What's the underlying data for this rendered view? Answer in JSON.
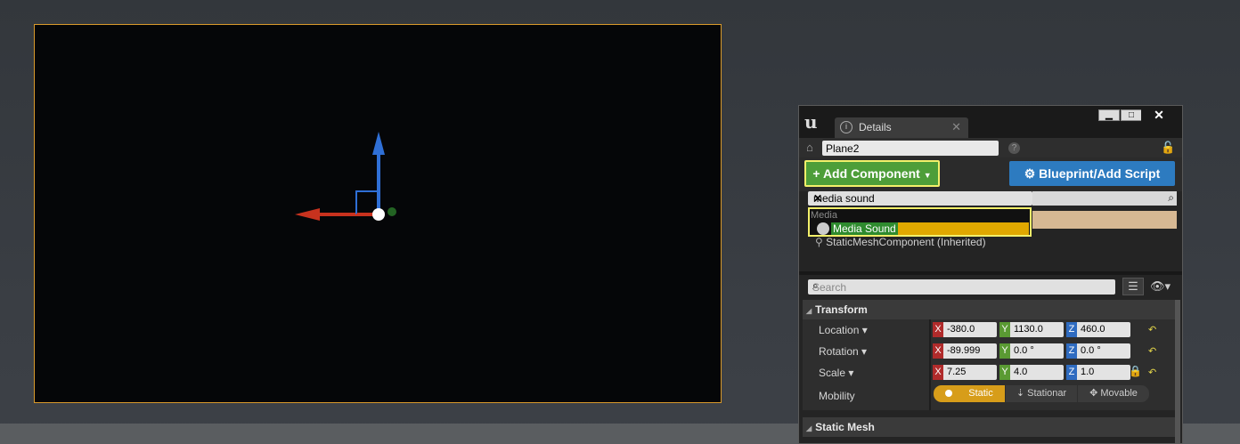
{
  "details_panel": {
    "tab_title": "Details",
    "actor_name": "Plane2",
    "add_component_label": "Add Component",
    "blueprint_label": "Blueprint/Add Script",
    "component_search_value": "media sound",
    "dropdown_category": "Media",
    "dropdown_item": "Media Sound",
    "component_tree_item": "StaticMeshComponent (Inherited)",
    "property_search_placeholder": "Search",
    "sections": {
      "transform": "Transform",
      "static_mesh": "Static Mesh"
    },
    "properties": {
      "location_label": "Location",
      "rotation_label": "Rotation",
      "scale_label": "Scale",
      "mobility_label": "Mobility",
      "location": {
        "x": "-380.0",
        "y": "1130.0",
        "z": "460.0"
      },
      "rotation": {
        "x": "-89.999",
        "y": "0.0 °",
        "z": "0.0 °"
      },
      "scale": {
        "x": "7.25",
        "y": "4.0",
        "z": "1.0"
      },
      "mobility_options": [
        "Static",
        "Stationar",
        "Movable"
      ]
    },
    "window_buttons": {
      "minimize": "▁",
      "maximize": "□",
      "close": "✕"
    },
    "axis_labels": {
      "x": "X",
      "y": "Y",
      "z": "Z"
    }
  },
  "colors": {
    "selection_outline": "#d99a2b",
    "add_button": "#4e9e39",
    "blueprint_button": "#2d7bc0",
    "highlight": "#f3f06a",
    "static_active": "#d79d1a"
  }
}
